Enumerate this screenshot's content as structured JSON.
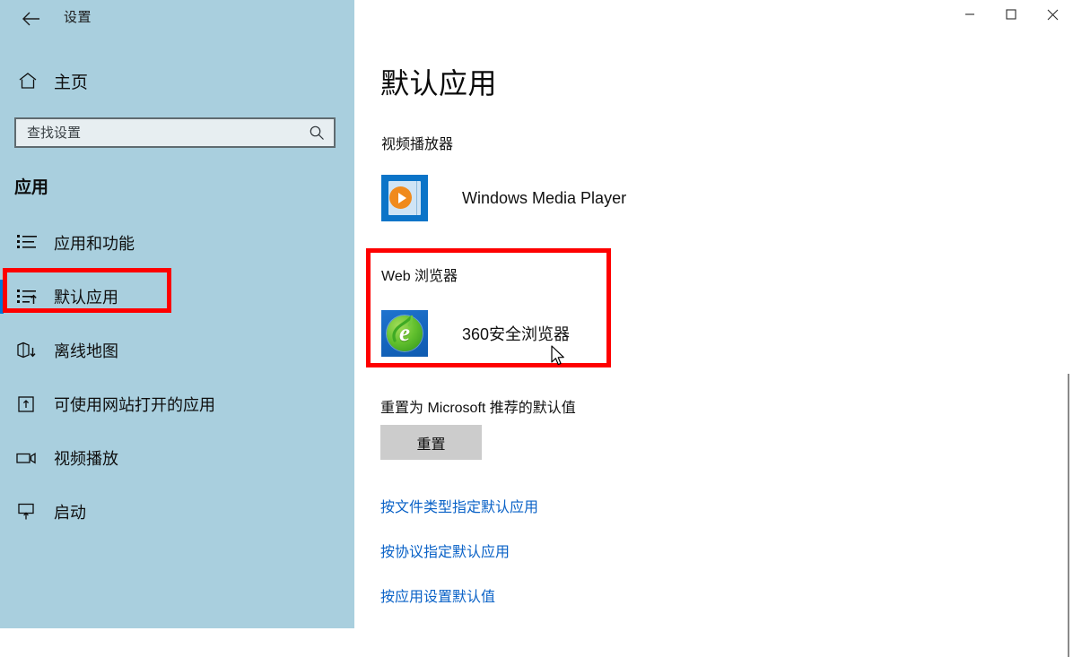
{
  "window": {
    "title": "设置",
    "back_icon": "back-arrow-icon",
    "controls": [
      {
        "name": "minimize-button",
        "icon": "minimize-icon",
        "label": "—"
      },
      {
        "name": "maximize-button",
        "icon": "maximize-icon",
        "label": "□"
      },
      {
        "name": "close-button",
        "icon": "close-icon",
        "label": "✕"
      }
    ]
  },
  "sidebar": {
    "home": {
      "label": "主页",
      "icon": "home-icon"
    },
    "search": {
      "value": "",
      "placeholder": "查找设置",
      "icon": "search-icon"
    },
    "section_heading": "应用",
    "items": [
      {
        "label": "应用和功能",
        "icon": "apps-list-icon",
        "selected": false
      },
      {
        "label": "默认应用",
        "icon": "default-apps-icon",
        "selected": true
      },
      {
        "label": "离线地图",
        "icon": "offline-maps-icon",
        "selected": false
      },
      {
        "label": "可使用网站打开的应用",
        "icon": "apps-for-websites-icon",
        "selected": false
      },
      {
        "label": "视频播放",
        "icon": "video-playback-icon",
        "selected": false
      },
      {
        "label": "启动",
        "icon": "startup-icon",
        "selected": false
      }
    ]
  },
  "main": {
    "page_title": "默认应用",
    "groups": [
      {
        "label": "视频播放器",
        "app_name": "Windows Media Player",
        "app_icon": "windows-media-player-icon"
      },
      {
        "label": "Web 浏览器",
        "app_name": "360安全浏览器",
        "app_icon": "360-browser-icon"
      }
    ],
    "reset": {
      "label": "重置为 Microsoft 推荐的默认值",
      "button_label": "重置"
    },
    "links": [
      "按文件类型指定默认应用",
      "按协议指定默认应用",
      "按应用设置默认值"
    ]
  },
  "annotations": {
    "highlight_color": "#fe0000",
    "sidebar_target": "默认应用",
    "browser_target": "Web 浏览器"
  },
  "colors": {
    "sidebar_bg": "#a9cfde",
    "accent": "#0078d7",
    "link": "#0a62c7",
    "main_bg": "#ffffff",
    "button_bg": "#cccccc"
  }
}
